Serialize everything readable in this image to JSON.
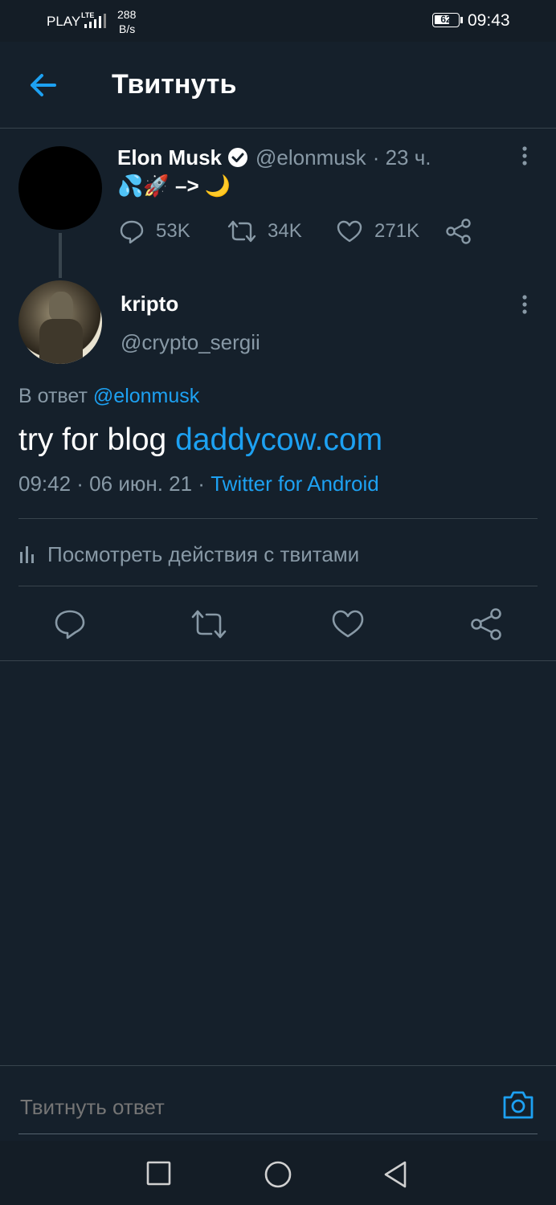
{
  "status_bar": {
    "carrier": "PLAY",
    "network": "LTE",
    "speed_value": "288",
    "speed_unit": "B/s",
    "battery": "62",
    "time": "09:43"
  },
  "header": {
    "title": "Твитнуть"
  },
  "parent_tweet": {
    "name": "Elon Musk",
    "handle": "@elonmusk",
    "age": "· 23 ч.",
    "text_emoji": "💦🚀",
    "text_arrow": "–>",
    "text_moon": "🌙",
    "replies": "53K",
    "retweets": "34K",
    "likes": "271K"
  },
  "reply_tweet": {
    "name": "kripto",
    "handle": "@crypto_sergii",
    "reply_to_prefix": "В ответ",
    "reply_to_handle": "@elonmusk",
    "text": "try for blog",
    "link": "daddycow.com",
    "timestamp": "09:42 · 06 июн. 21 ·",
    "source": "Twitter for Android",
    "activity_label": "Посмотреть действия с твитами"
  },
  "composer": {
    "placeholder": "Твитнуть ответ"
  },
  "colors": {
    "background": "#15202b",
    "accent": "#1da1f2",
    "muted": "#8899a6",
    "divider": "#38444d"
  }
}
